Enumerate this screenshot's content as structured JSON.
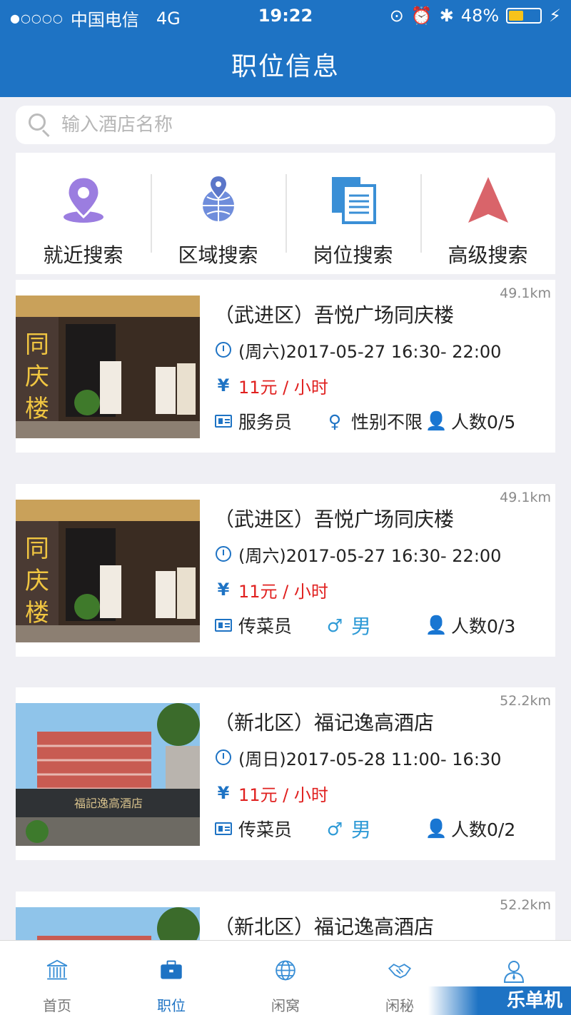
{
  "status_bar": {
    "signal": "●○○○○",
    "carrier": "中国电信",
    "network": "4G",
    "time": "19:22",
    "battery": "48%",
    "battery_level": 0.48
  },
  "header": {
    "title": "职位信息"
  },
  "search": {
    "placeholder": "输入酒店名称",
    "value": ""
  },
  "quick_menu": [
    {
      "label": "就近搜索",
      "icon": "location-pin-icon",
      "color": "#9b7de0"
    },
    {
      "label": "区域搜索",
      "icon": "globe-pin-icon",
      "color": "#6f8ddb"
    },
    {
      "label": "岗位搜索",
      "icon": "documents-icon",
      "color": "#3a8fd6"
    },
    {
      "label": "高级搜索",
      "icon": "arrow-up-icon",
      "color": "#d9646a"
    }
  ],
  "jobs": [
    {
      "distance": "49.1km",
      "title": "（武进区）吾悦广场同庆楼",
      "time": "(周六)2017-05-27 16:30- 22:00",
      "wage": "11元 / 小时",
      "position": "服务员",
      "gender": "性别不限",
      "gender_type": "any",
      "count": "人数0/5",
      "image": "restaurant-storefront"
    },
    {
      "distance": "49.1km",
      "title": "（武进区）吾悦广场同庆楼",
      "time": "(周六)2017-05-27 16:30- 22:00",
      "wage": "11元 / 小时",
      "position": "传菜员",
      "gender": "男",
      "gender_type": "male",
      "count": "人数0/3",
      "image": "restaurant-storefront"
    },
    {
      "distance": "52.2km",
      "title": "（新北区）福记逸高酒店",
      "time": "(周日)2017-05-28 11:00- 16:30",
      "wage": "11元 / 小时",
      "position": "传菜员",
      "gender": "男",
      "gender_type": "male",
      "count": "人数0/2",
      "image": "hotel-building"
    },
    {
      "distance": "52.2km",
      "title": "（新北区）福记逸高酒店",
      "image": "hotel-building"
    }
  ],
  "tabbar": [
    {
      "label": "首页",
      "icon": "bank-icon",
      "active": false
    },
    {
      "label": "职位",
      "icon": "briefcase-icon",
      "active": true
    },
    {
      "label": "闲窝",
      "icon": "globe-icon",
      "active": false
    },
    {
      "label": "闲秘",
      "icon": "handshake-icon",
      "active": false
    },
    {
      "label": "",
      "icon": "user-icon",
      "active": false
    }
  ],
  "watermark": "乐单机",
  "colors": {
    "primary": "#1e73c4",
    "wage": "#e0201f",
    "male": "#2e9ad6"
  }
}
